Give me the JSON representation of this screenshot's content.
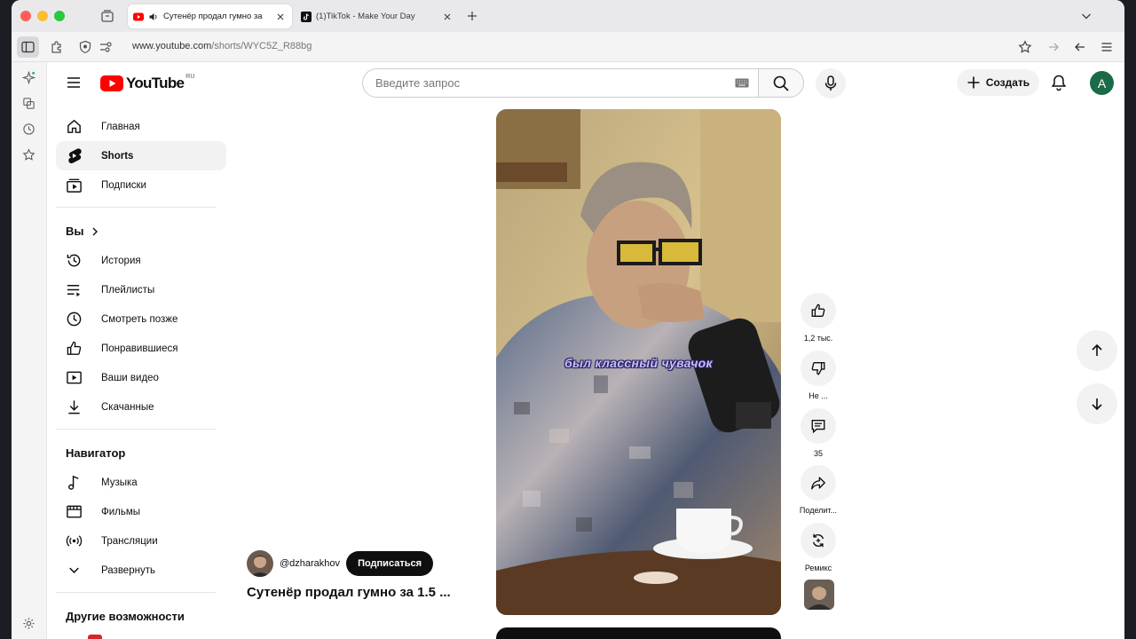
{
  "browser": {
    "tabs": [
      {
        "title": "Сутенёр продал гумно за",
        "active": true
      },
      {
        "title": "(1)TikTok - Make Your Day",
        "active": false
      }
    ],
    "url_host": "www.youtube.com",
    "url_path": "/shorts/WYC5Z_R88bg"
  },
  "header": {
    "logo_text": "YouTube",
    "country_code": "RU",
    "search_placeholder": "Введите запрос",
    "create_label": "Создать",
    "avatar_letter": "A"
  },
  "sidebar": {
    "main": [
      {
        "label": "Главная",
        "icon": "home-icon"
      },
      {
        "label": "Shorts",
        "icon": "shorts-icon",
        "active": true
      },
      {
        "label": "Подписки",
        "icon": "subscriptions-icon"
      }
    ],
    "you_title": "Вы",
    "you": [
      {
        "label": "История",
        "icon": "history-icon"
      },
      {
        "label": "Плейлисты",
        "icon": "playlists-icon"
      },
      {
        "label": "Смотреть позже",
        "icon": "watch-later-icon"
      },
      {
        "label": "Понравившиеся",
        "icon": "liked-icon"
      },
      {
        "label": "Ваши видео",
        "icon": "your-videos-icon"
      },
      {
        "label": "Скачанные",
        "icon": "downloads-icon"
      }
    ],
    "navigator_title": "Навигатор",
    "navigator": [
      {
        "label": "Музыка",
        "icon": "music-icon"
      },
      {
        "label": "Фильмы",
        "icon": "movies-icon"
      },
      {
        "label": "Трансляции",
        "icon": "live-icon"
      },
      {
        "label": "Развернуть",
        "icon": "chevron-down-icon"
      }
    ],
    "more_title": "Другие возможности"
  },
  "short": {
    "caption": "был классный чувачок",
    "channel": "@dzharakhov",
    "subscribe_label": "Подписаться",
    "title": "Сутенёр продал гумно за 1.5 ..."
  },
  "actions": {
    "likes": "1,2 тыс.",
    "dislike": "Не ...",
    "comments": "35",
    "share": "Поделит...",
    "remix": "Ремикс"
  },
  "colors": {
    "youtube_red": "#ff0000",
    "caption": "#c8bfff",
    "avatar": "#1b6b48"
  }
}
